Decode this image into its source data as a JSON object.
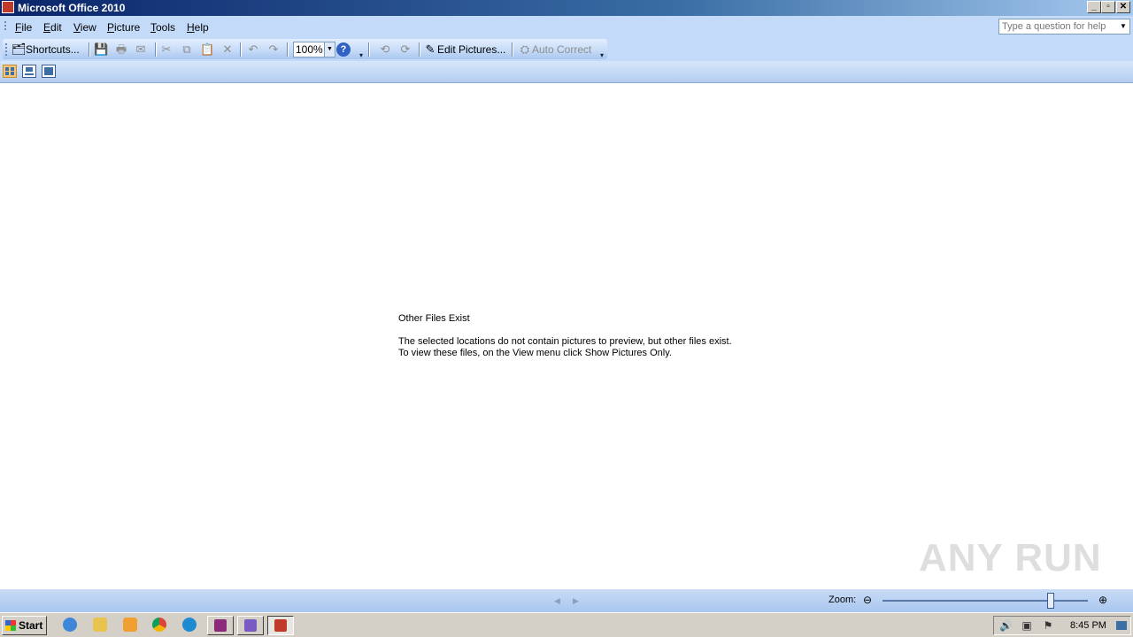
{
  "window": {
    "title": "Microsoft Office 2010",
    "controls": [
      "minimize",
      "restore",
      "close"
    ]
  },
  "menu": {
    "items": [
      {
        "label": "File",
        "hotkey": "F"
      },
      {
        "label": "Edit",
        "hotkey": "E"
      },
      {
        "label": "View",
        "hotkey": "V"
      },
      {
        "label": "Picture",
        "hotkey": "P"
      },
      {
        "label": "Tools",
        "hotkey": "T"
      },
      {
        "label": "Help",
        "hotkey": "H"
      }
    ],
    "help_placeholder": "Type a question for help"
  },
  "toolbar": {
    "shortcuts_label": "Shortcuts...",
    "zoom_value": "100%",
    "edit_pictures_label": "Edit Pictures...",
    "auto_correct_label": "Auto Correct"
  },
  "main": {
    "heading": "Other Files Exist",
    "line1": "The selected locations do not contain pictures to preview, but other files exist.",
    "line2": "To view these files, on the View menu click Show Pictures Only."
  },
  "statusbar": {
    "zoom_label": "Zoom:",
    "zoom_level_fraction": 0.82
  },
  "taskbar": {
    "start_label": "Start",
    "clock": "8:45 PM"
  },
  "watermark": "ANY RUN"
}
